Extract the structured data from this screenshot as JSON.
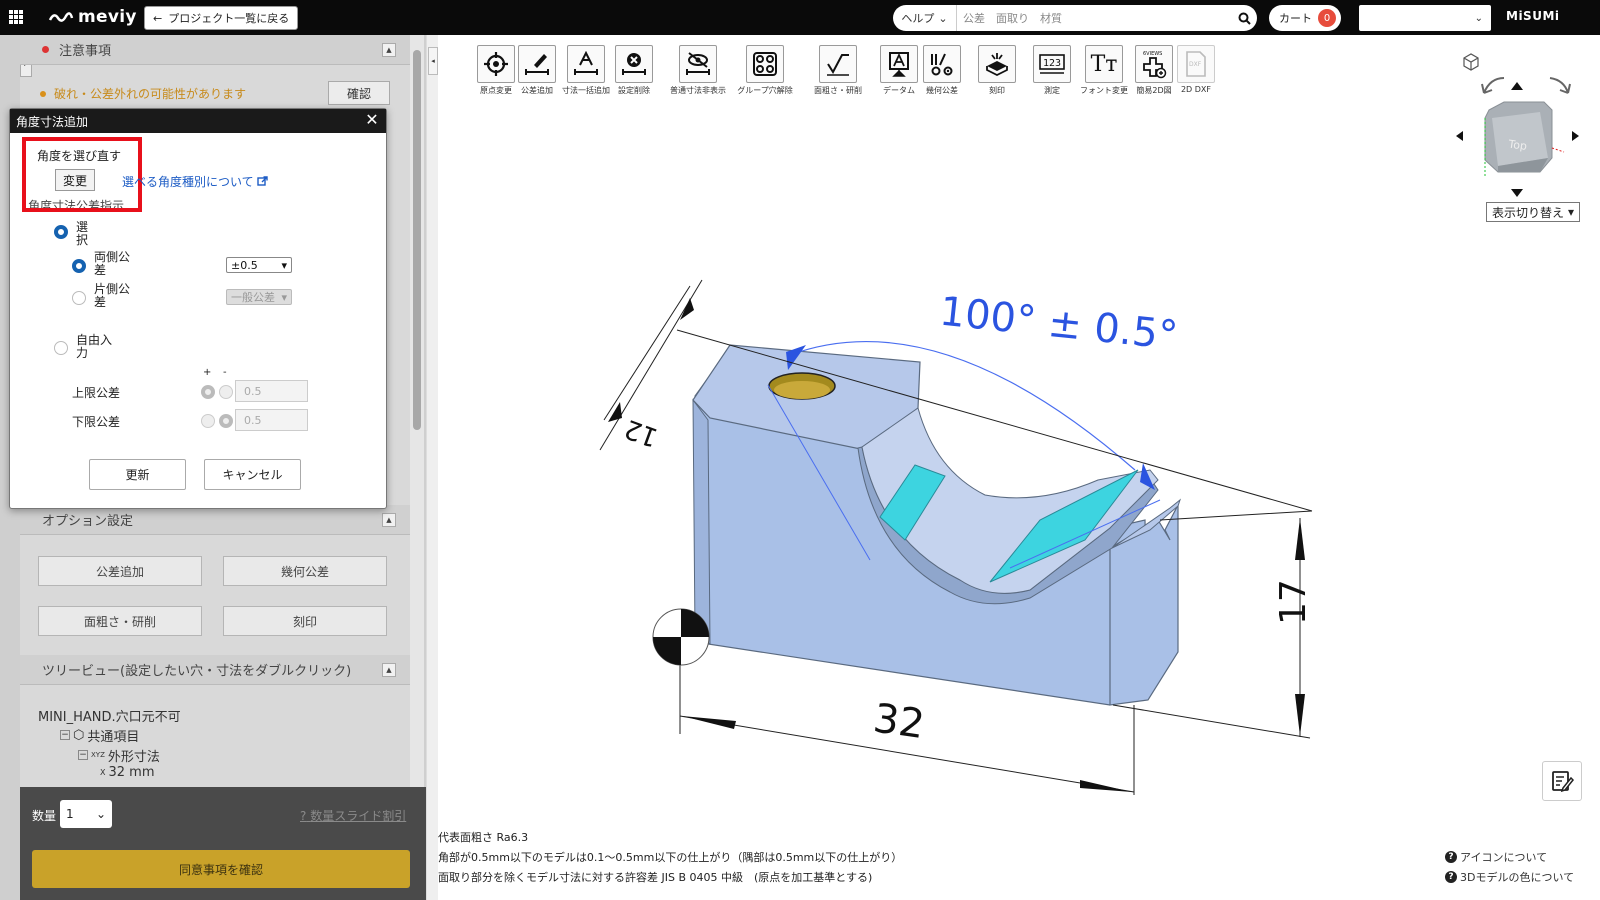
{
  "header": {
    "logo": "meviy",
    "back_label": "プロジェクト一覧に戻る",
    "help_label": "ヘルプ",
    "search_placeholder": "公差　面取り　材質",
    "cart_label": "カート",
    "cart_count": "0",
    "brand": "MiSUMi"
  },
  "left_panel": {
    "notice_title": "注意事項",
    "notice_text": "破れ・公差外れの可能性があります",
    "notice_confirm": "確認",
    "option_title": "オプション設定",
    "option_buttons": [
      "公差追加",
      "幾何公差",
      "面粗さ・研削",
      "刻印"
    ],
    "tree_title": "ツリービュー(設定したい穴・寸法をダブルクリック)",
    "tree_items": [
      "MINI_HAND.穴口元不可",
      "共通項目",
      "外形寸法",
      "32 mm"
    ],
    "tree_icon_xyz": "XYZ",
    "tree_icon_x": "X",
    "quantity_label": "数量",
    "quantity_value": "1",
    "slide_link": "数量スライド割引",
    "agree_button": "同意事項を確認"
  },
  "dialog": {
    "title": "角度寸法追加",
    "reselect_label": "角度を選び直す",
    "change_button": "変更",
    "angle_types_link": "選べる角度種別について",
    "tolerance_heading": "角度寸法公差指示",
    "select_option": "選択",
    "both_sides": "両側公差",
    "both_sides_value": "±0.5",
    "one_side": "片側公差",
    "one_side_value": "一般公差",
    "free_input": "自由入力",
    "plus": "+",
    "minus": "-",
    "upper_label": "上限公差",
    "upper_value": "0.5",
    "lower_label": "下限公差",
    "lower_value": "0.5",
    "update_button": "更新",
    "cancel_button": "キャンセル"
  },
  "toolbar": [
    {
      "label": "原点変更",
      "icon": "origin-icon"
    },
    {
      "label": "公差追加",
      "icon": "tolerance-add-icon"
    },
    {
      "label": "寸法一括追加",
      "icon": "dimension-bulk-icon"
    },
    {
      "label": "設定削除",
      "icon": "delete-setting-icon"
    },
    {
      "label": "普通寸法非表示",
      "icon": "hide-dimension-icon"
    },
    {
      "label": "グループ穴解除",
      "icon": "group-hole-icon"
    },
    {
      "label": "面粗さ・研削",
      "icon": "roughness-icon"
    },
    {
      "label": "データム",
      "icon": "datum-icon"
    },
    {
      "label": "幾何公差",
      "icon": "geometric-tolerance-icon"
    },
    {
      "label": "刻印",
      "icon": "engrave-icon"
    },
    {
      "label": "測定",
      "icon": "measure-icon"
    },
    {
      "label": "フォント変更",
      "icon": "font-icon"
    },
    {
      "label": "簡易2D図",
      "icon": "six-views-icon"
    },
    {
      "label": "2D DXF",
      "icon": "dxf-icon"
    }
  ],
  "toolbar_badges": {
    "six_views": "6VIEWS",
    "dxf": "DXF",
    "measure": "123",
    "font": "Tт"
  },
  "viewport": {
    "angle_annotation": "100°  ± 0.5°",
    "dim_width": "32",
    "dim_height": "17",
    "dim_depth": "12",
    "cube_face": "Top",
    "view_switch": "表示切り替え"
  },
  "footer_notes": [
    "代表面粗さ Ra6.3",
    "角部が0.5mm以下のモデルは0.1～0.5mm以下の仕上がり（隅部は0.5mm以下の仕上がり）",
    "面取り部分を除くモデル寸法に対する許容差 JIS B 0405 中級　(原点を加工基準とする)"
  ],
  "help_links": [
    "アイコンについて",
    "3Dモデルの色について"
  ],
  "colors": {
    "header_bg": "#0a0a0a",
    "accent_blue": "#1562b0",
    "annotation_blue": "#2b54e0",
    "part_face": "#aec3e6",
    "highlight_cyan": "#3dd4e0",
    "agree_gold": "#c9a229",
    "alert_red": "#e8101b"
  }
}
